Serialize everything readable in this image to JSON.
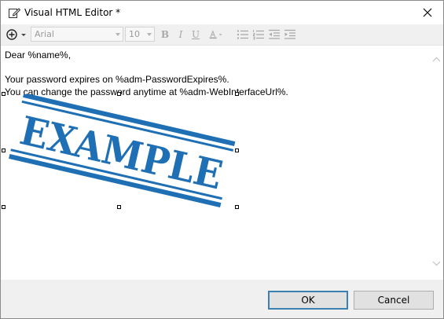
{
  "window": {
    "title": "Visual HTML Editor *"
  },
  "toolbar": {
    "font_family": "Arial",
    "font_size": "10",
    "bold_label": "B",
    "italic_label": "I",
    "underline_label": "U",
    "font_color_label": "A"
  },
  "editor": {
    "lines": [
      "Dear %name%,",
      "Your password expires on %adm-PasswordExpires%.",
      "You can change the password anytime at %adm-WebInterfaceUrl%."
    ],
    "stamp_text": "EXAMPLE"
  },
  "buttons": {
    "ok_label": "OK",
    "cancel_label": "Cancel"
  },
  "colors": {
    "stamp_blue": "#1f6fb5",
    "accent": "#3c7fb1"
  }
}
